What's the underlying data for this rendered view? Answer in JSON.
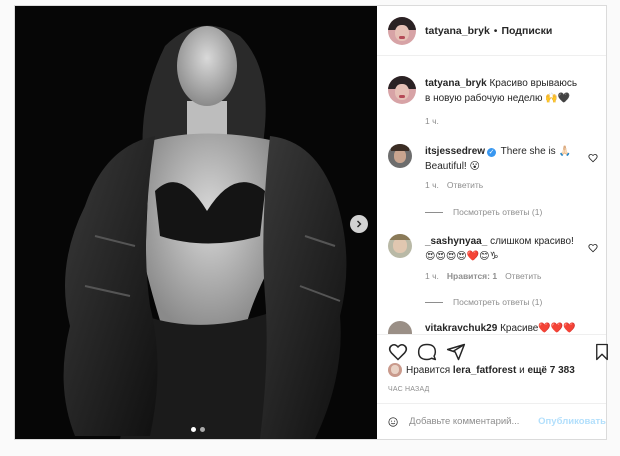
{
  "header": {
    "username": "tatyana_bryk",
    "separator": "•",
    "follow_label": "Подписки"
  },
  "caption": {
    "username": "tatyana_bryk",
    "text": "Красиво врываюсь в новую рабочую неделю",
    "emoji": "🙌🖤",
    "time": "1 ч."
  },
  "comments": [
    {
      "username": "itsjessedrew",
      "verified": true,
      "text_before": "There she is",
      "text_after": "Beautiful!",
      "emoji_mid": "🙏🏻",
      "emoji_end": "😮",
      "time": "1 ч.",
      "reply_label": "Ответить",
      "view_replies": "Посмотреть ответы (1)"
    },
    {
      "username": "_sashynyaa_",
      "text": "слишком красиво!",
      "emoji": "😍😍😍😍❤️😊♑",
      "time": "1 ч.",
      "likes": "Нравится: 1",
      "reply_label": "Ответить",
      "view_replies": "Посмотреть ответы (1)"
    },
    {
      "username": "vitakravchuk29",
      "text": "Красиве",
      "emoji": "❤️❤️❤️"
    }
  ],
  "likes": {
    "prefix": "Нравится",
    "user": "lera_fatforest",
    "connector": "и",
    "others": "ещё 7 383"
  },
  "time_ago": "ЧАС НАЗАД",
  "add_comment": {
    "placeholder": "Добавьте комментарий...",
    "publish_label": "Опубликовать"
  },
  "colors": {
    "link_blue": "#3897f0",
    "publish_disabled": "#b2dffc",
    "muted": "#8e8e8e"
  },
  "icons": [
    "heart-icon",
    "comment-icon",
    "share-icon",
    "bookmark-icon",
    "emoji-icon",
    "chevron-right-icon",
    "verified-icon"
  ]
}
